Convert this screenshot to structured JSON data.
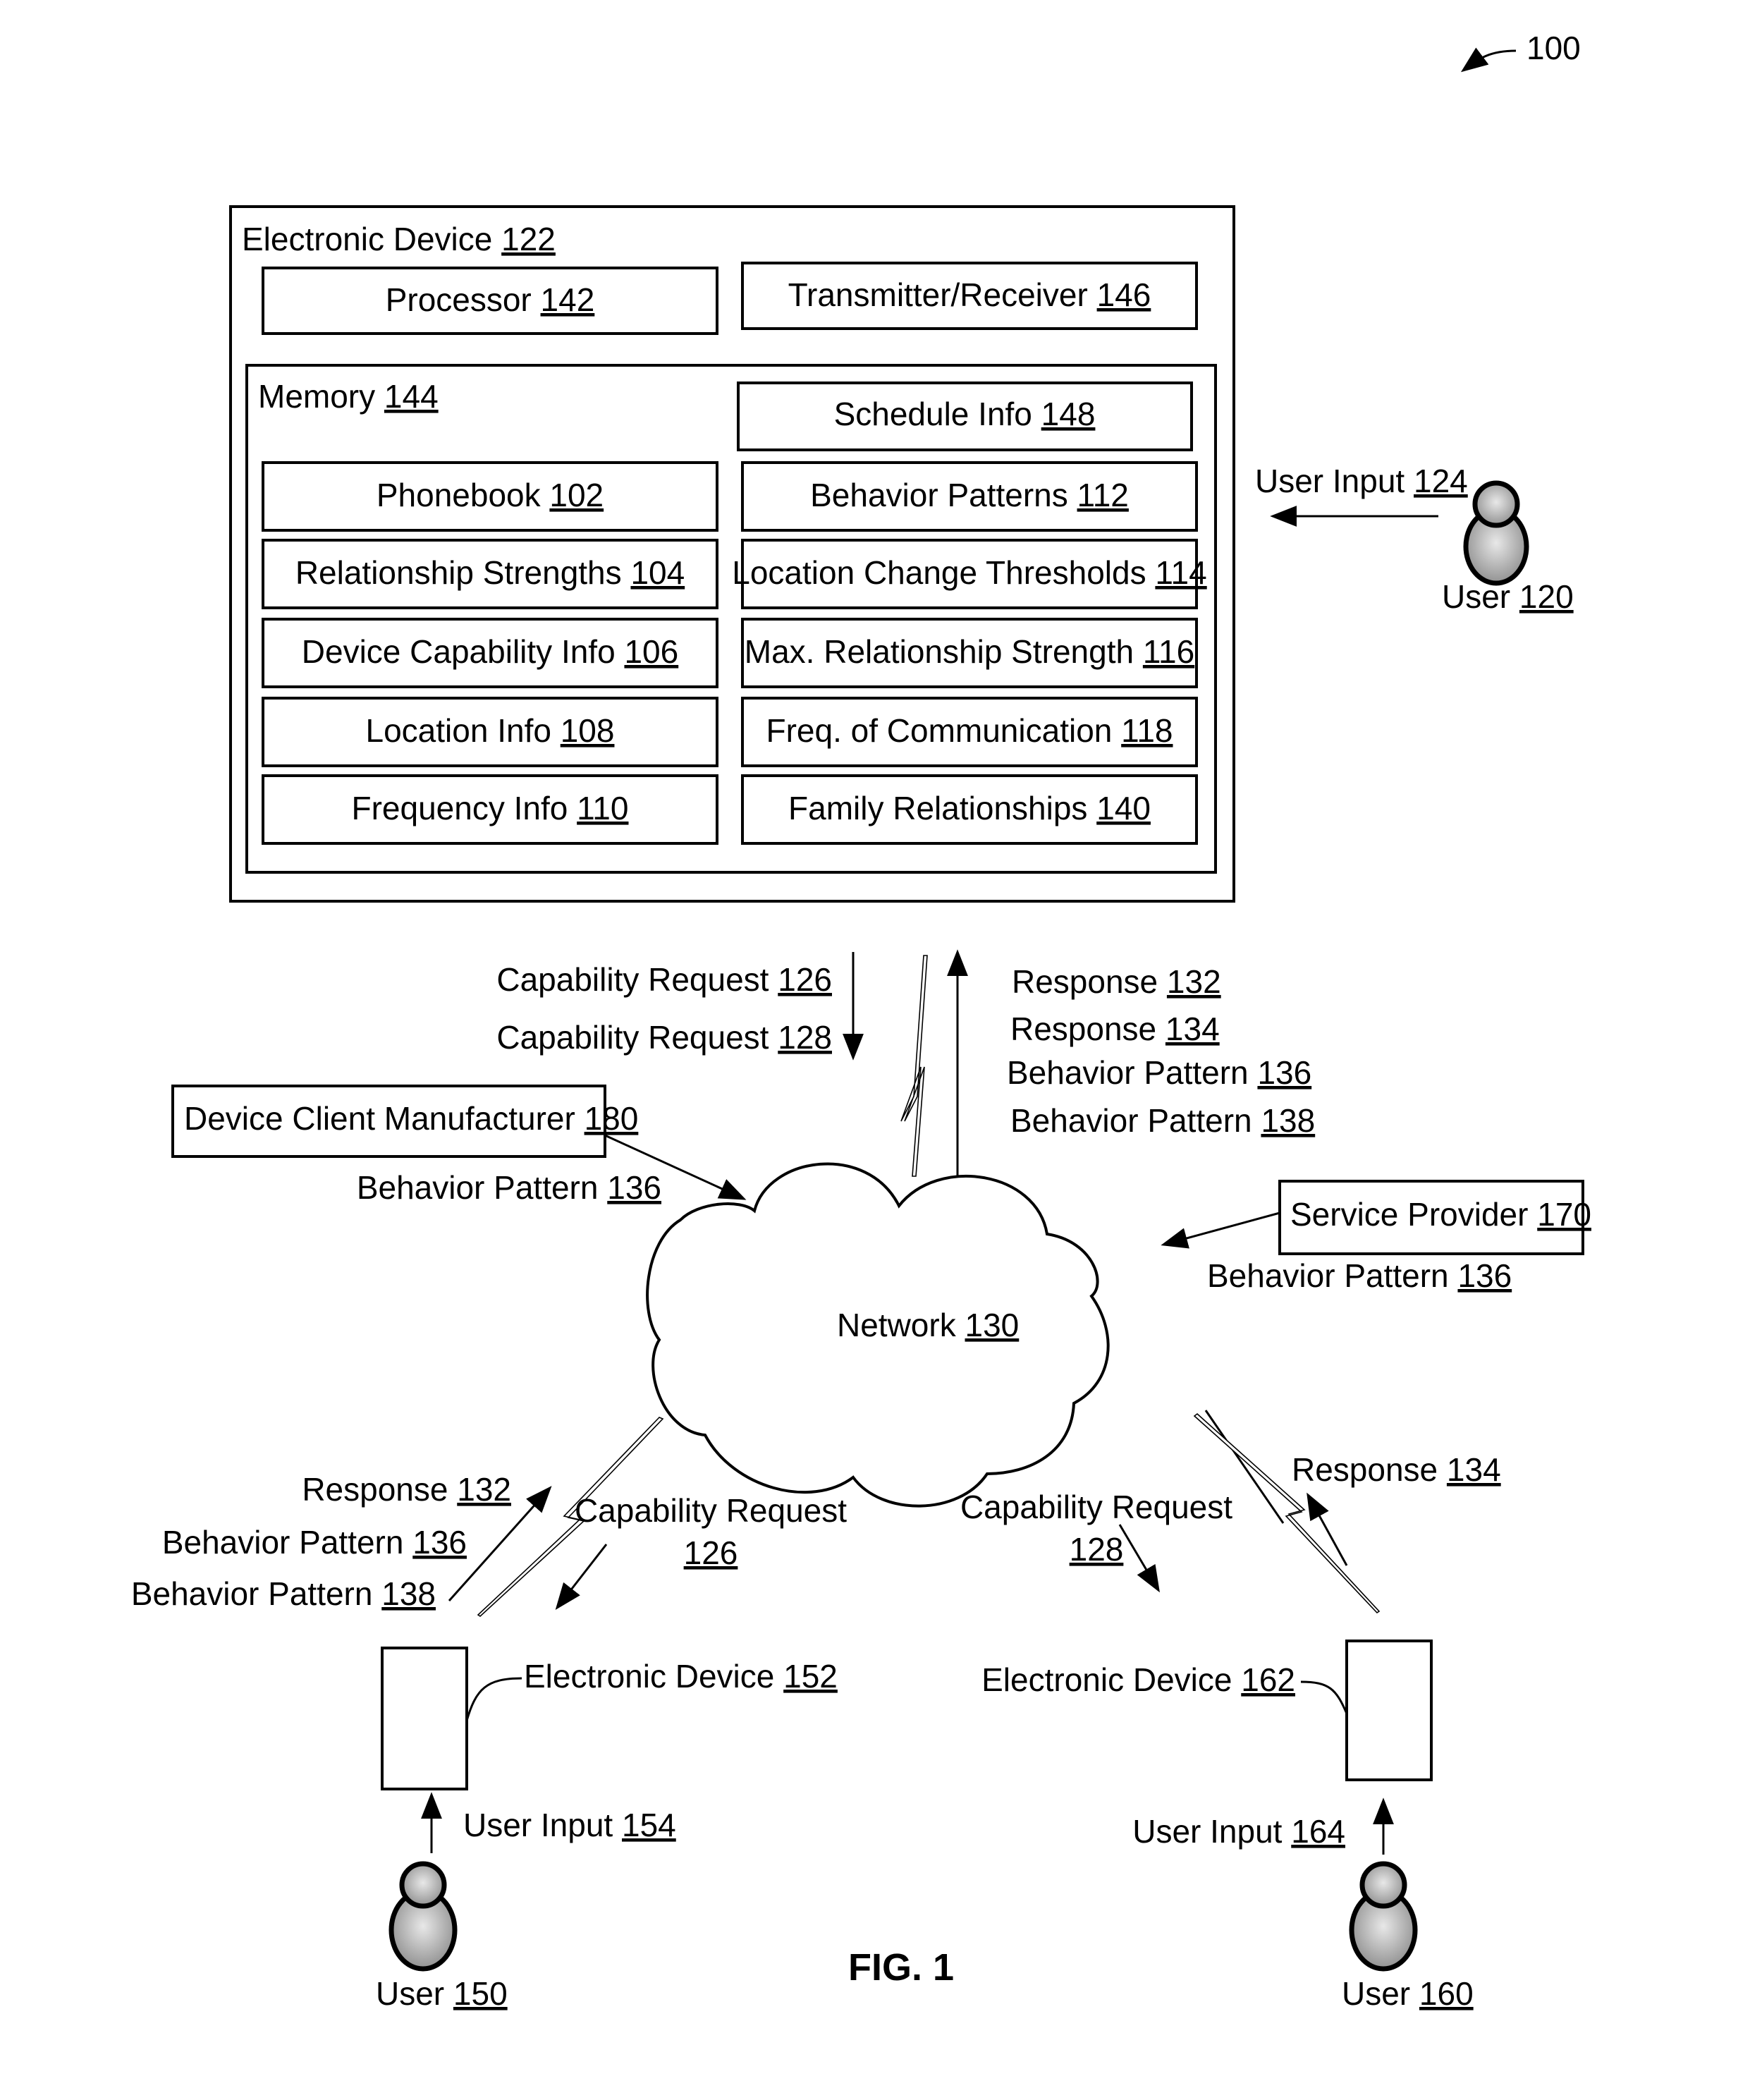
{
  "figure": {
    "ref": "100",
    "caption": "FIG. 1"
  },
  "electronic_device_122": {
    "title": "Electronic Device",
    "num": "122",
    "processor": {
      "label": "Processor",
      "num": "142"
    },
    "transceiver": {
      "label": "Transmitter/Receiver",
      "num": "146"
    },
    "memory": {
      "title": "Memory",
      "num": "144",
      "schedule": {
        "label": "Schedule Info",
        "num": "148"
      },
      "left": [
        {
          "label": "Phonebook",
          "num": "102"
        },
        {
          "label": "Relationship Strengths",
          "num": "104"
        },
        {
          "label": "Device Capability Info",
          "num": "106"
        },
        {
          "label": "Location Info",
          "num": "108"
        },
        {
          "label": "Frequency Info",
          "num": "110"
        }
      ],
      "right": [
        {
          "label": "Behavior Patterns",
          "num": "112"
        },
        {
          "label": "Location Change Thresholds",
          "num": "114"
        },
        {
          "label": "Max. Relationship Strength",
          "num": "116"
        },
        {
          "label": "Freq. of Communication",
          "num": "118"
        },
        {
          "label": "Family Relationships",
          "num": "140"
        }
      ]
    }
  },
  "user_120": {
    "input": {
      "label": "User Input",
      "num": "124"
    },
    "user": {
      "label": "User",
      "num": "120"
    }
  },
  "top_link": {
    "down": [
      {
        "label": "Capability Request",
        "num": "126"
      },
      {
        "label": "Capability Request",
        "num": "128"
      }
    ],
    "up": [
      {
        "label": "Response",
        "num": "132"
      },
      {
        "label": "Response",
        "num": "134"
      },
      {
        "label": "Behavior Pattern",
        "num": "136"
      },
      {
        "label": "Behavior Pattern",
        "num": "138"
      }
    ]
  },
  "device_client_manufacturer": {
    "label": "Device Client Manufacturer",
    "num": "180",
    "sends": {
      "label": "Behavior Pattern",
      "num": "136"
    }
  },
  "service_provider": {
    "label": "Service Provider",
    "num": "170",
    "sends": {
      "label": "Behavior Pattern",
      "num": "136"
    }
  },
  "network": {
    "label": "Network",
    "num": "130"
  },
  "left_link": {
    "up": [
      {
        "label": "Response",
        "num": "132"
      },
      {
        "label": "Behavior Pattern",
        "num": "136"
      },
      {
        "label": "Behavior Pattern",
        "num": "138"
      }
    ],
    "down": {
      "label": "Capability Request",
      "num": "126"
    }
  },
  "right_link": {
    "up": {
      "label": "Response",
      "num": "134"
    },
    "down": {
      "label": "Capability Request",
      "num": "128"
    }
  },
  "device_152": {
    "label": "Electronic Device",
    "num": "152",
    "input": {
      "label": "User Input",
      "num": "154"
    },
    "user": {
      "label": "User",
      "num": "150"
    }
  },
  "device_162": {
    "label": "Electronic Device",
    "num": "162",
    "input": {
      "label": "User Input",
      "num": "164"
    },
    "user": {
      "label": "User",
      "num": "160"
    }
  }
}
